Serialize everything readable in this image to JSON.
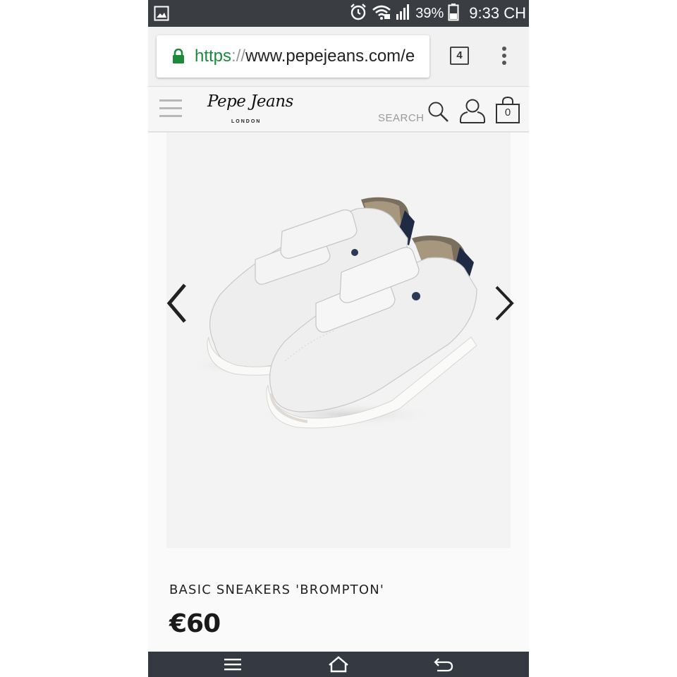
{
  "status_bar": {
    "battery_percent": "39%",
    "time": "9:33 CH",
    "icons": [
      "gallery-icon",
      "alarm-icon",
      "wifi-icon",
      "signal-icon",
      "battery-icon"
    ]
  },
  "browser": {
    "url_scheme": "https",
    "url_separator": "://",
    "url_rest": "www.pepejeans.com/e",
    "tab_count": "4"
  },
  "header": {
    "logo_script": "Pepe Jeans",
    "logo_sub": "LONDON",
    "search_label": "SEARCH",
    "bag_count": "0"
  },
  "product": {
    "name": "BASIC SNEAKERS 'BROMPTON'",
    "price": "€60"
  },
  "colors": {
    "status_bar": "#3a3d42",
    "secure_green": "#1b8a3a",
    "nav_bar": "#353a42",
    "gallery_bg": "#f3f3f3"
  }
}
